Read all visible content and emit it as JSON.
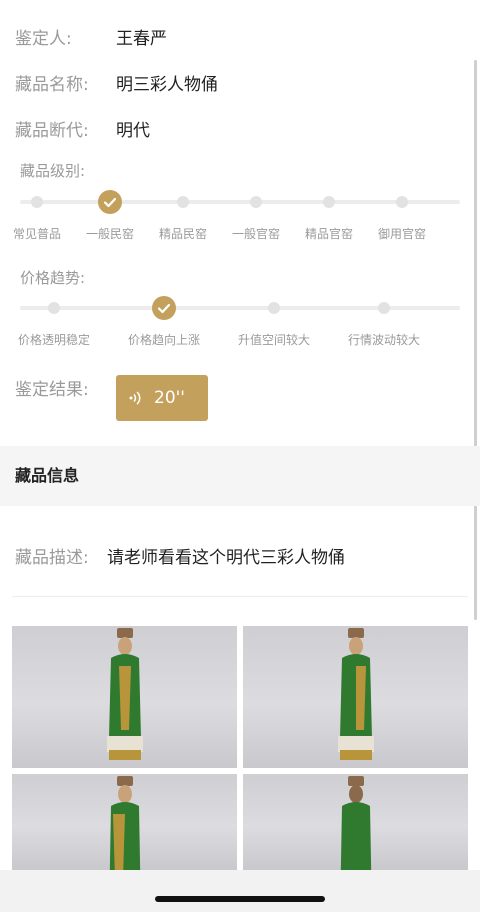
{
  "details": {
    "appraiser_label": "鉴定人:",
    "appraiser_value": "王春严",
    "name_label": "藏品名称:",
    "name_value": "明三彩人物俑",
    "era_label": "藏品断代:",
    "era_value": "明代"
  },
  "grade": {
    "label": "藏品级别:",
    "options": [
      "常见普品",
      "一般民窑",
      "精品民窑",
      "一般官窑",
      "精品官窑",
      "御用官窑"
    ],
    "selected_index": 1
  },
  "price_trend": {
    "label": "价格趋势:",
    "options": [
      "价格透明稳定",
      "价格趋向上涨",
      "升值空间较大",
      "行情波动较大"
    ],
    "selected_index": 1
  },
  "result": {
    "label": "鉴定结果:",
    "voice_duration": "20''"
  },
  "collection_info": {
    "title": "藏品信息",
    "desc_label": "藏品描述:",
    "desc_value": "请老师看看这个明代三彩人物俑"
  },
  "colors": {
    "accent": "#c3a05c",
    "label": "#9a9a9a",
    "text": "#222222"
  }
}
